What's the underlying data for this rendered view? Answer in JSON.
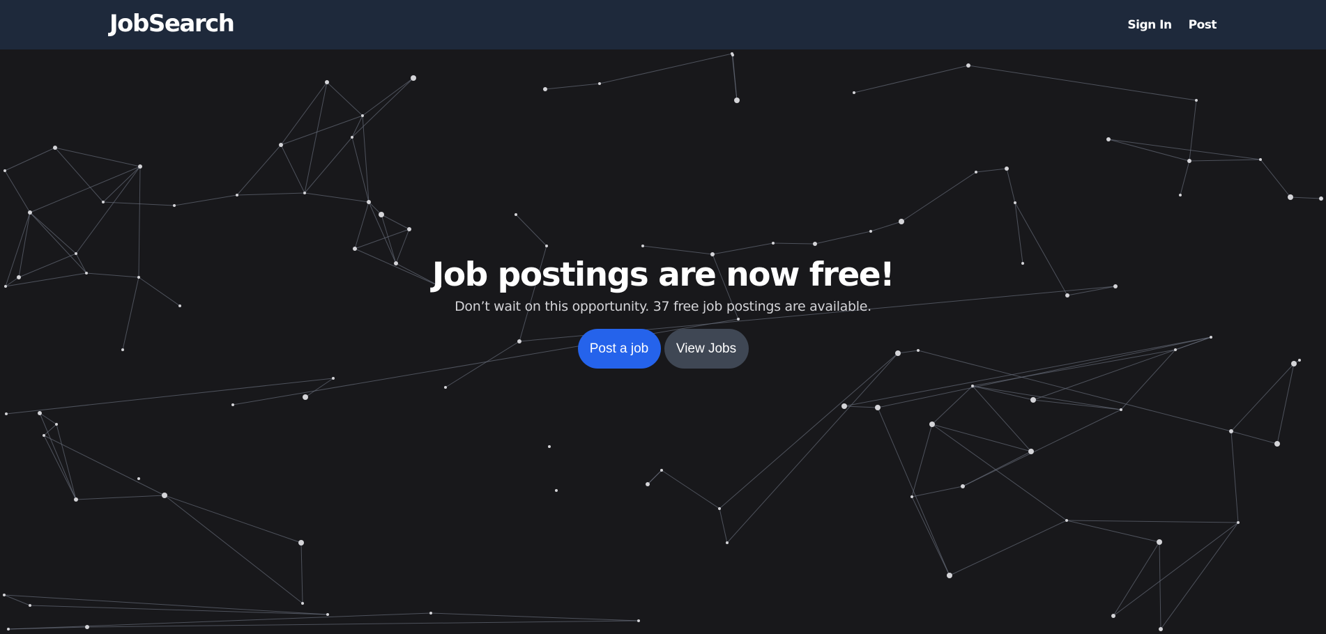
{
  "navbar": {
    "brand": "JobSearch",
    "links": [
      {
        "label": "Sign In"
      },
      {
        "label": "Post"
      }
    ]
  },
  "hero": {
    "title": "Job postings are now free!",
    "subtitle": "Don’t wait on this opportunity. 37 free job postings are available.",
    "primary_button": "Post a job",
    "secondary_button": "View Jobs"
  },
  "colors": {
    "background": "#18181b",
    "navbar": "#1e293b",
    "primary": "#2563eb",
    "secondary": "#3f4754",
    "node": "#d4d4d8",
    "edge": "#6b7280"
  }
}
